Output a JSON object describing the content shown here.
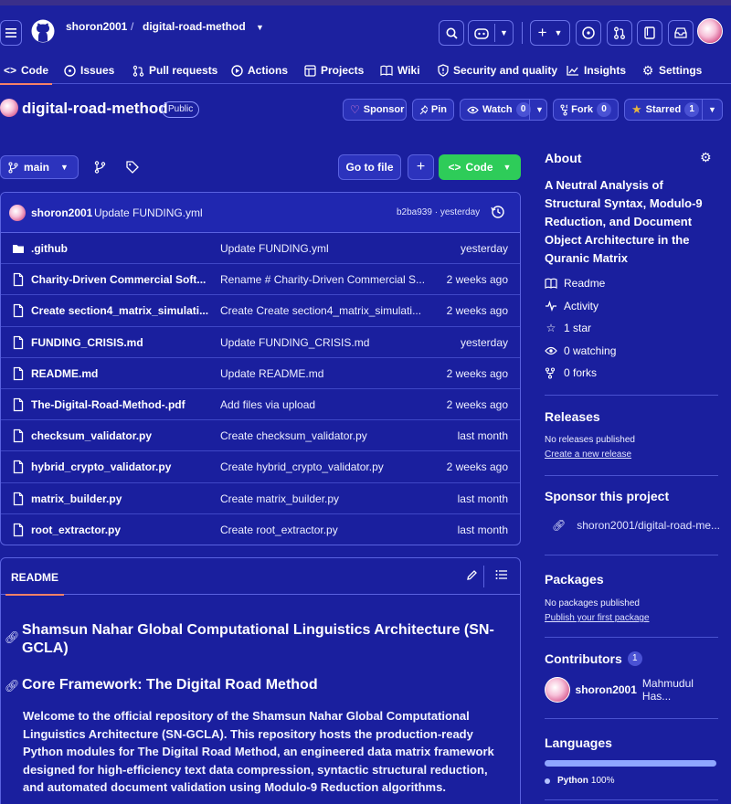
{
  "header": {
    "owner": "shoron2001",
    "repo": "digital-road-method",
    "nav_tabs": [
      {
        "label": "Code",
        "icon": "code-icon"
      },
      {
        "label": "Issues",
        "icon": "issue-icon"
      },
      {
        "label": "Pull requests",
        "icon": "pull-request-icon"
      },
      {
        "label": "Actions",
        "icon": "play-icon"
      },
      {
        "label": "Projects",
        "icon": "table-icon"
      },
      {
        "label": "Wiki",
        "icon": "book-icon"
      },
      {
        "label": "Security and quality",
        "icon": "shield-icon"
      },
      {
        "label": "Insights",
        "icon": "graph-icon"
      },
      {
        "label": "Settings",
        "icon": "gear-icon"
      }
    ]
  },
  "repo": {
    "name": "digital-road-method",
    "visibility": "Public",
    "sponsor_label": "Sponsor",
    "pin_label": "Pin",
    "watch_label": "Watch",
    "watch_count": "0",
    "fork_label": "Fork",
    "fork_count": "0",
    "starred_label": "Starred",
    "star_count": "1"
  },
  "toolbar": {
    "branch": "main",
    "goto_file": "Go to file",
    "code_label": "Code"
  },
  "latest_commit": {
    "user": "shoron2001",
    "message": "Update FUNDING.yml",
    "hash_time": "b2ba939 · yesterday"
  },
  "files": [
    {
      "type": "folder",
      "name": ".github",
      "message": "Update FUNDING.yml",
      "date": "yesterday"
    },
    {
      "type": "file",
      "name": "Charity-Driven Commercial Soft...",
      "message": "Rename # Charity-Driven Commercial S...",
      "date": "2 weeks ago"
    },
    {
      "type": "file",
      "name": "Create section4_matrix_simulati...",
      "message": "Create Create section4_matrix_simulati...",
      "date": "2 weeks ago"
    },
    {
      "type": "file",
      "name": "FUNDING_CRISIS.md",
      "message": "Update FUNDING_CRISIS.md",
      "date": "yesterday"
    },
    {
      "type": "file",
      "name": "README.md",
      "message": "Update README.md",
      "date": "2 weeks ago"
    },
    {
      "type": "file",
      "name": "The-Digital-Road-Method-.pdf",
      "message": "Add files via upload",
      "date": "2 weeks ago"
    },
    {
      "type": "file",
      "name": "checksum_validator.py",
      "message": "Create checksum_validator.py",
      "date": "last month"
    },
    {
      "type": "file",
      "name": "hybrid_crypto_validator.py",
      "message": "Create hybrid_crypto_validator.py",
      "date": "2 weeks ago"
    },
    {
      "type": "file",
      "name": "matrix_builder.py",
      "message": "Create matrix_builder.py",
      "date": "last month"
    },
    {
      "type": "file",
      "name": "root_extractor.py",
      "message": "Create root_extractor.py",
      "date": "last month"
    }
  ],
  "readme": {
    "tab": "README",
    "h1": "Shamsun Nahar Global Computational Linguistics Architecture (SN-GCLA)",
    "h2": "Core Framework: The Digital Road Method",
    "paragraph": "Welcome to the official repository of the Shamsun Nahar Global Computational Linguistics Architecture (SN-GCLA). This repository hosts the production-ready Python modules for The Digital Road Method, an engineered data matrix framework designed for high-efficiency text data compression, syntactic structural reduction, and automated document validation using Modulo-9 Reduction algorithms."
  },
  "sidebar": {
    "about_title": "About",
    "description": "A Neutral Analysis of Structural Syntax, Modulo-9 Reduction, and Document Object Architecture in the Quranic Matrix",
    "readme": "Readme",
    "activity": "Activity",
    "stars": "1 star",
    "watching": "0 watching",
    "forks": "0 forks",
    "releases_title": "Releases",
    "releases_text": "No releases published",
    "releases_link": "Create a new release",
    "sponsor_title": "Sponsor this project",
    "sponsor_link": "shoron2001/digital-road-me...",
    "packages_title": "Packages",
    "packages_text": "No packages published",
    "packages_link": "Publish your first package",
    "contributors_title": "Contributors",
    "contributors_count": "1",
    "contributor_user": "shoron2001",
    "contributor_name": "Mahmudul Has...",
    "languages_title": "Languages",
    "language": "Python",
    "language_pct": "100%"
  },
  "colors": {
    "background": "#1a1f9e",
    "accent_green": "#2ecc59",
    "tab_underline": "#f78166"
  }
}
